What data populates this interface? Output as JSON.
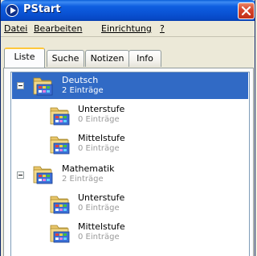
{
  "window": {
    "title": "PStart"
  },
  "menu": [
    {
      "label": "Datei"
    },
    {
      "label": "Bearbeiten"
    },
    {
      "label": "Einrichtung"
    },
    {
      "label": "?"
    }
  ],
  "tabs": [
    {
      "label": "Liste",
      "active": true
    },
    {
      "label": "Suche",
      "active": false
    },
    {
      "label": "Notizen",
      "active": false
    },
    {
      "label": "Info",
      "active": false
    }
  ],
  "tree": [
    {
      "title": "Deutsch",
      "count": "2 Einträge",
      "level": 0,
      "expanded": true,
      "selected": true
    },
    {
      "title": "Unterstufe",
      "count": "0 Einträge",
      "level": 1,
      "selected": false
    },
    {
      "title": "Mittelstufe",
      "count": "0 Einträge",
      "level": 1,
      "selected": false
    },
    {
      "title": "Mathematik",
      "count": "2 Einträge",
      "level": 0,
      "expanded": true,
      "selected": false
    },
    {
      "title": "Unterstufe",
      "count": "0 Einträge",
      "level": 1,
      "selected": false
    },
    {
      "title": "Mittelstufe",
      "count": "0 Einträge",
      "level": 1,
      "selected": false
    }
  ],
  "icons": {
    "app": "pstart-app-icon",
    "close": "close-icon",
    "expander": "collapse-icon",
    "folder": "program-folder-icon"
  },
  "colors": {
    "titlebar": "#0a54d6",
    "selection": "#316ac5",
    "active_tab_accent": "#ffc83c",
    "close_button": "#d5432b"
  }
}
